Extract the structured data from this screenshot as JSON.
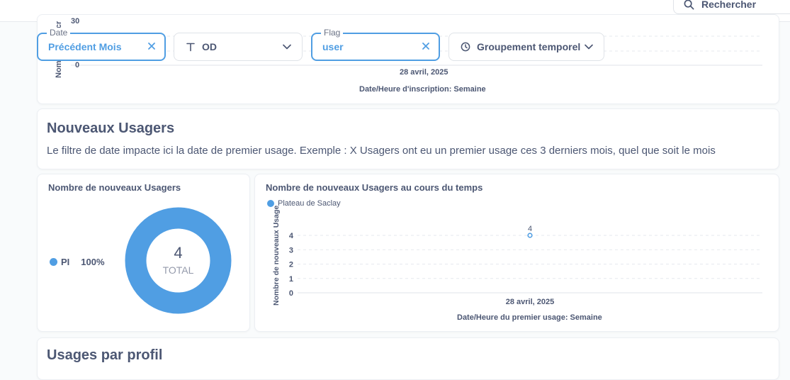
{
  "search": {
    "label": "Rechercher"
  },
  "filters": {
    "date": {
      "legend": "Date",
      "value": "Précédent Mois"
    },
    "od": {
      "value": "OD"
    },
    "flag": {
      "legend": "Flag",
      "value": "user"
    },
    "grouping": {
      "value": "Groupement temporel"
    }
  },
  "top_chart": {
    "y_axis_partial": "Nombre d'inscr",
    "y_ticks": [
      "30",
      "0"
    ],
    "x_tick": "28 avril, 2025",
    "x_label": "Date/Heure d'inscription: Semaine"
  },
  "section": {
    "title": "Nouveaux Usagers",
    "description": "Le filtre de date impacte ici la date de premier usage. Exemple : X Usagers ont eu un premier usage ces 3 derniers mois, quel que soit le mois"
  },
  "donut_card": {
    "title": "Nombre de nouveaux Usagers",
    "legend_label": "PI",
    "legend_pct": "100%",
    "total_value": "4",
    "total_label": "TOTAL",
    "color": "#509ee3"
  },
  "line_card": {
    "title": "Nombre de nouveaux Usagers au cours du temps",
    "legend": "Plateau de Saclay",
    "color": "#509ee3"
  },
  "chart_data": {
    "type": "line",
    "series": [
      {
        "name": "Plateau de Saclay",
        "values": [
          4
        ]
      }
    ],
    "x": [
      "28 avril, 2025"
    ],
    "ylim": [
      0,
      4
    ],
    "yticks": [
      0,
      1,
      2,
      3,
      4
    ],
    "xlabel": "Date/Heure du premier usage: Semaine",
    "ylabel": "Nombre de nouveaux Usage",
    "data_labels": [
      "4"
    ],
    "grid": true
  },
  "next_section": {
    "title": "Usages par profil"
  }
}
